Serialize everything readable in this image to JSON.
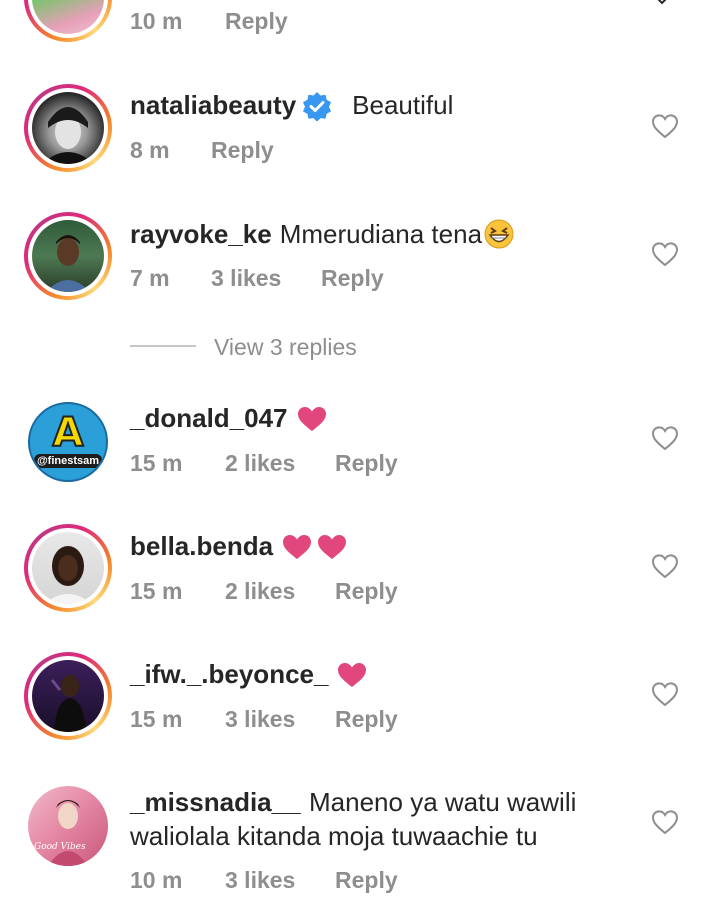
{
  "comments": [
    {
      "time": "10 m",
      "reply": "Reply"
    },
    {
      "username": "nataliabeauty",
      "text": "Beautiful",
      "time": "8 m",
      "reply": "Reply"
    },
    {
      "username": "rayvoke_ke",
      "text": "Mmerudiana tena",
      "emoji": "grinning-squinting-face",
      "time": "7 m",
      "likes": "3 likes",
      "reply": "Reply"
    },
    {
      "username": "_donald_047",
      "time": "15 m",
      "likes": "2 likes",
      "reply": "Reply"
    },
    {
      "username": "bella.benda",
      "time": "15 m",
      "likes": "2 likes",
      "reply": "Reply"
    },
    {
      "username": "_ifw._.beyonce_",
      "time": "15 m",
      "likes": "3 likes",
      "reply": "Reply"
    },
    {
      "username": "_missnadia__",
      "text_line1": "Maneno ya watu wawili",
      "text_line2": "waliolala kitanda moja tuwaachie tu",
      "time": "10 m",
      "likes": "3 likes",
      "reply": "Reply"
    }
  ],
  "view_replies": "View 3 replies",
  "avatar_badge_text": "@finestsam",
  "avatar_badge_letter": "A",
  "avatar_script_text": "Good Vibes",
  "colors": {
    "pink_heart": "#e1467c",
    "verified": "#3897f0",
    "meta": "#8e8e8e"
  }
}
